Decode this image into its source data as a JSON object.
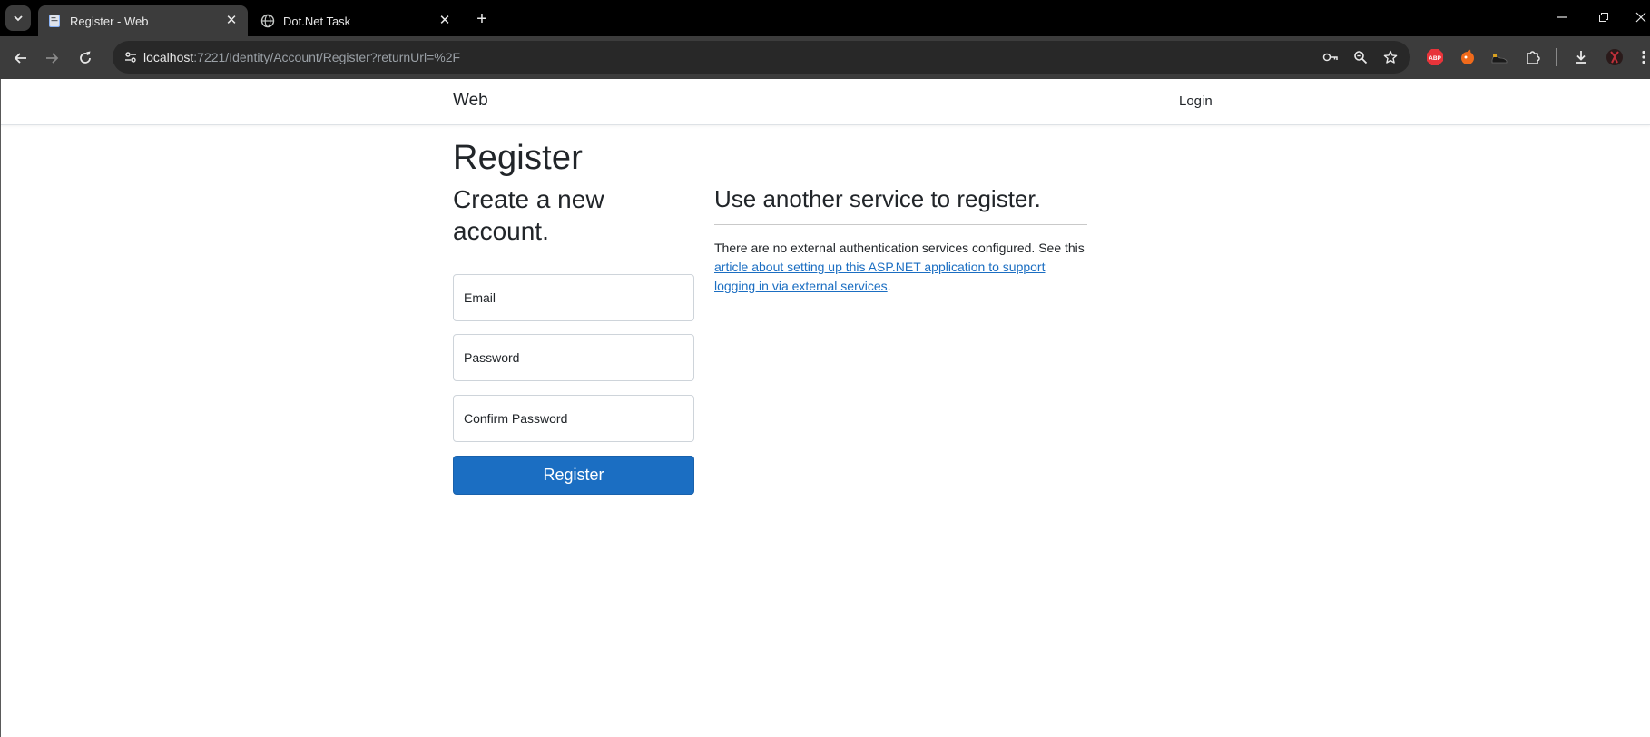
{
  "browser": {
    "tabs": [
      {
        "title": "Register - Web",
        "active": true
      },
      {
        "title": "Dot.Net Task",
        "active": false
      }
    ],
    "address": {
      "host": "localhost",
      "rest": ":7221/Identity/Account/Register?returnUrl=%2F"
    },
    "icons": {
      "tab_search": "chevron-down-icon",
      "new_tab": "plus-icon",
      "back": "back-arrow-icon",
      "forward": "forward-arrow-icon",
      "reload": "reload-icon",
      "site_info": "site-info-icon",
      "password": "key-icon",
      "zoom": "zoom-icon",
      "bookmark": "star-icon",
      "extensions": "puzzle-icon",
      "downloads": "download-icon",
      "menu": "kebab-menu-icon"
    },
    "extensions": [
      {
        "name": "adblock-icon",
        "label": "ABP",
        "color": "#e8343a"
      },
      {
        "name": "extension-orange-icon",
        "color": "#f06a1b"
      },
      {
        "name": "extension-shoe-icon",
        "color": "#1a1a1a"
      }
    ]
  },
  "navbar": {
    "brand": "Web",
    "login": "Login"
  },
  "register": {
    "title": "Register",
    "subtitle": "Create a new account.",
    "email_placeholder": "Email",
    "password_placeholder": "Password",
    "confirm_placeholder": "Confirm Password",
    "submit_label": "Register"
  },
  "external": {
    "title": "Use another service to register.",
    "text_before": "There are no external authentication services configured. See this ",
    "link_text": "article about setting up this ASP.NET application to support logging in via external services",
    "text_after": "."
  },
  "colors": {
    "primary": "#1b6ec2",
    "text": "#212529",
    "chrome_dark": "#3c3c3c"
  }
}
